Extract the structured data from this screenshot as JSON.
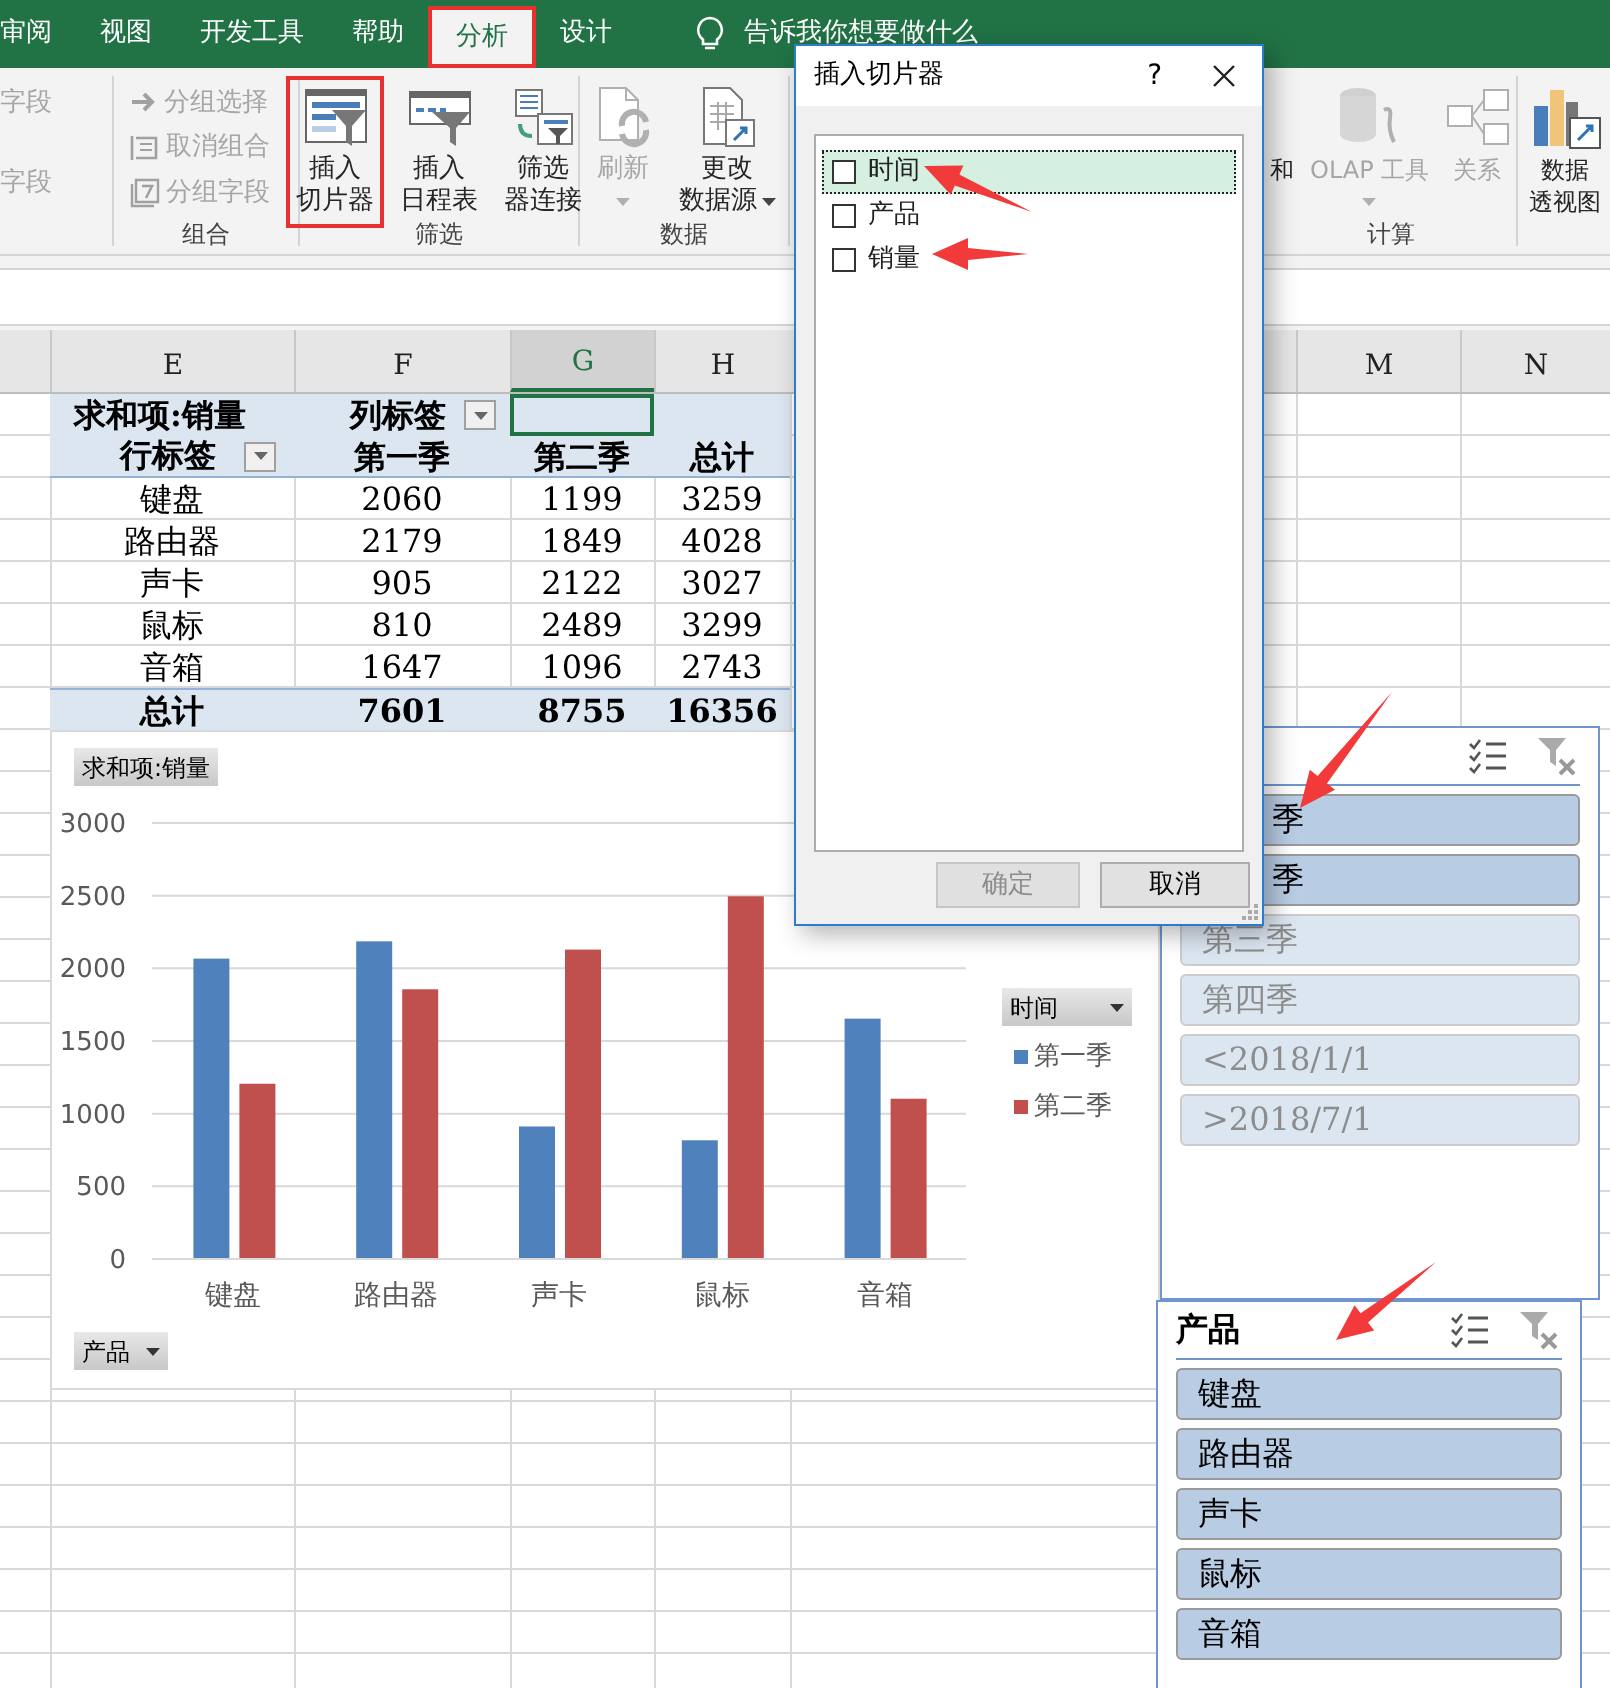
{
  "tabs": [
    {
      "label": "审阅",
      "selected": false,
      "highlighted": false
    },
    {
      "label": "视图",
      "selected": false,
      "highlighted": false
    },
    {
      "label": "开发工具",
      "selected": false,
      "highlighted": false
    },
    {
      "label": "帮助",
      "selected": false,
      "highlighted": false
    },
    {
      "label": "分析",
      "selected": true,
      "highlighted": true
    },
    {
      "label": "设计",
      "selected": false,
      "highlighted": false
    }
  ],
  "tell_me": "告诉我你想要做什么",
  "ribbon": {
    "left_groups": [
      {
        "kind": "small",
        "items": [
          {
            "label": "字段",
            "disabled": true
          },
          {
            "label": "字段",
            "disabled": true
          }
        ]
      },
      {
        "kind": "small",
        "label": "组合",
        "items": [
          {
            "label": "分组选择",
            "disabled": true
          },
          {
            "label": "取消组合",
            "disabled": true
          },
          {
            "label": "分组字段",
            "disabled": true
          }
        ]
      },
      {
        "kind": "large",
        "label": "筛选",
        "items": [
          {
            "lines": [
              "插入",
              "切片器"
            ],
            "disabled": false,
            "highlighted": true
          },
          {
            "lines": [
              "插入",
              "日程表"
            ],
            "disabled": false,
            "highlighted": false
          },
          {
            "lines": [
              "筛选",
              "器连接"
            ],
            "disabled": false,
            "highlighted": false
          }
        ]
      },
      {
        "kind": "large",
        "label": "数据",
        "items": [
          {
            "lines": [
              "刷新"
            ],
            "disabled": true,
            "dropdown": true
          },
          {
            "lines": [
              "更改",
              "数据源"
            ],
            "disabled": false,
            "dropdown": true
          }
        ]
      }
    ],
    "right_groups": [
      {
        "label": "计算",
        "items": [
          {
            "lines": [
              "和"
            ],
            "disabled": false
          },
          {
            "lines": [
              "OLAP 工具"
            ],
            "disabled": true,
            "dropdown": true
          },
          {
            "lines": [
              "关系"
            ],
            "disabled": true
          }
        ]
      },
      {
        "items": [
          {
            "lines": [
              "数据",
              "透视图"
            ],
            "disabled": false
          }
        ]
      }
    ]
  },
  "column_headers": [
    {
      "label": "E",
      "selected": false
    },
    {
      "label": "F",
      "selected": false
    },
    {
      "label": "G",
      "selected": true
    },
    {
      "label": "H",
      "selected": false
    },
    {
      "label": "M",
      "selected": false
    },
    {
      "label": "N",
      "selected": false
    }
  ],
  "pivot_table": {
    "value_field": "求和项:销量",
    "column_label": "列标签",
    "row_label": "行标签",
    "columns": [
      "第一季",
      "第二季",
      "总计"
    ],
    "rows": [
      {
        "label": "键盘",
        "values": [
          "2060",
          "1199",
          "3259"
        ]
      },
      {
        "label": "路由器",
        "values": [
          "2179",
          "1849",
          "4028"
        ]
      },
      {
        "label": "声卡",
        "values": [
          "905",
          "2122",
          "3027"
        ]
      },
      {
        "label": "鼠标",
        "values": [
          "810",
          "2489",
          "3299"
        ]
      },
      {
        "label": "音箱",
        "values": [
          "1647",
          "1096",
          "2743"
        ]
      }
    ],
    "total": {
      "label": "总计",
      "values": [
        "7601",
        "8755",
        "16356"
      ]
    }
  },
  "chart": {
    "value_button": "求和项:销量",
    "legend_button": "时间",
    "axis_button": "产品",
    "chart_data": {
      "type": "bar",
      "categories": [
        "键盘",
        "路由器",
        "声卡",
        "鼠标",
        "音箱"
      ],
      "series": [
        {
          "name": "第一季",
          "color": "#4f81bd",
          "values": [
            2060,
            2179,
            905,
            810,
            1647
          ]
        },
        {
          "name": "第二季",
          "color": "#c0504d",
          "values": [
            1199,
            1849,
            2122,
            2489,
            1096
          ]
        }
      ],
      "ylim": [
        0,
        3000
      ],
      "yticks": [
        0,
        500,
        1000,
        1500,
        2000,
        2500,
        3000
      ],
      "grid": true,
      "legend": true
    }
  },
  "slicers": [
    {
      "items": [
        {
          "label": "季",
          "selected": true,
          "covered": true
        },
        {
          "label": "季",
          "selected": true,
          "covered": true
        },
        {
          "label": "第三季",
          "selected": false,
          "covered": false
        },
        {
          "label": "第四季",
          "selected": false,
          "covered": false
        },
        {
          "label": "<2018/1/1",
          "selected": false,
          "covered": false
        },
        {
          "label": ">2018/7/1",
          "selected": false,
          "covered": false
        }
      ]
    },
    {
      "title": "产品",
      "items": [
        {
          "label": "键盘",
          "selected": true,
          "covered": false
        },
        {
          "label": "路由器",
          "selected": true,
          "covered": false
        },
        {
          "label": "声卡",
          "selected": true,
          "covered": false
        },
        {
          "label": "鼠标",
          "selected": true,
          "covered": false
        },
        {
          "label": "音箱",
          "selected": true,
          "covered": false
        }
      ]
    }
  ],
  "dialog": {
    "title": "插入切片器",
    "help": "?",
    "fields": [
      {
        "label": "时间",
        "checked": false,
        "selected": true
      },
      {
        "label": "产品",
        "checked": false,
        "selected": false
      },
      {
        "label": "销量",
        "checked": false,
        "selected": false
      }
    ],
    "buttons": [
      {
        "label": "确定",
        "disabled": true
      },
      {
        "label": "取消",
        "disabled": false
      }
    ]
  }
}
